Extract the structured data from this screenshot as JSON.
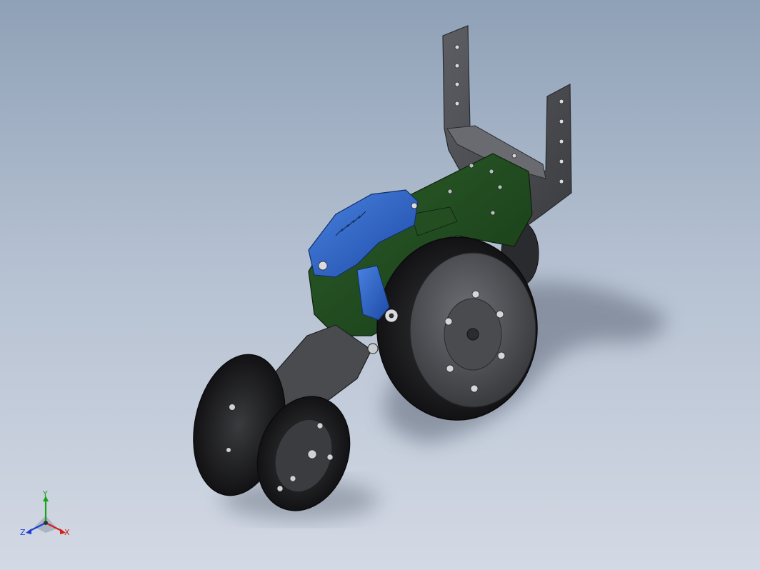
{
  "viewport": {
    "background_top": "#8fa1b7",
    "background_bottom": "#d3d9e4"
  },
  "model": {
    "colors": {
      "frame_green": "#1f4a1e",
      "gauge_blue": "#2f62c4",
      "bracket_gray": "#4e4f53",
      "tire_black": "#1c1c1e",
      "hub_gray": "#55565a"
    }
  },
  "triad": {
    "y_label": "Y",
    "z_label": "Z",
    "x_label": "X",
    "colors": {
      "x": "#d21f1f",
      "y": "#1aa31a",
      "z": "#1f3fd2"
    }
  }
}
